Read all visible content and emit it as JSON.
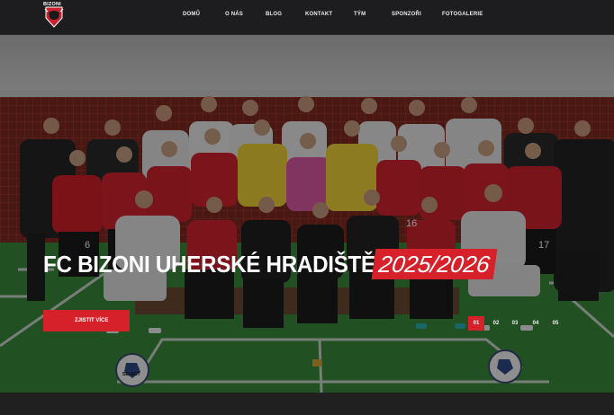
{
  "brand": {
    "logo_text": "BIZONI"
  },
  "nav": {
    "items": [
      {
        "label": "DOMŮ"
      },
      {
        "label": "O NÁS"
      },
      {
        "label": "BLOG"
      },
      {
        "label": "KONTAKT"
      },
      {
        "label": "TÝM"
      },
      {
        "label": "SPONZOŘI"
      },
      {
        "label": "FOTOGALERIE"
      }
    ]
  },
  "hero": {
    "title": "FC BIZONI UHERSKÉ HRADIŠTĚ",
    "season": "2025/2026",
    "cta_label": "ZJISTIT VÍCE",
    "slides": [
      "01",
      "02",
      "03",
      "04",
      "05"
    ],
    "active_slide": "01",
    "jersey_numbers": [
      "6",
      "16",
      "17"
    ],
    "ball_text": "SELECT"
  },
  "colors": {
    "accent": "#d6202a",
    "navbar": "#1d1d1f",
    "floor": "#3a8a3c",
    "net": "#a33a2c"
  }
}
